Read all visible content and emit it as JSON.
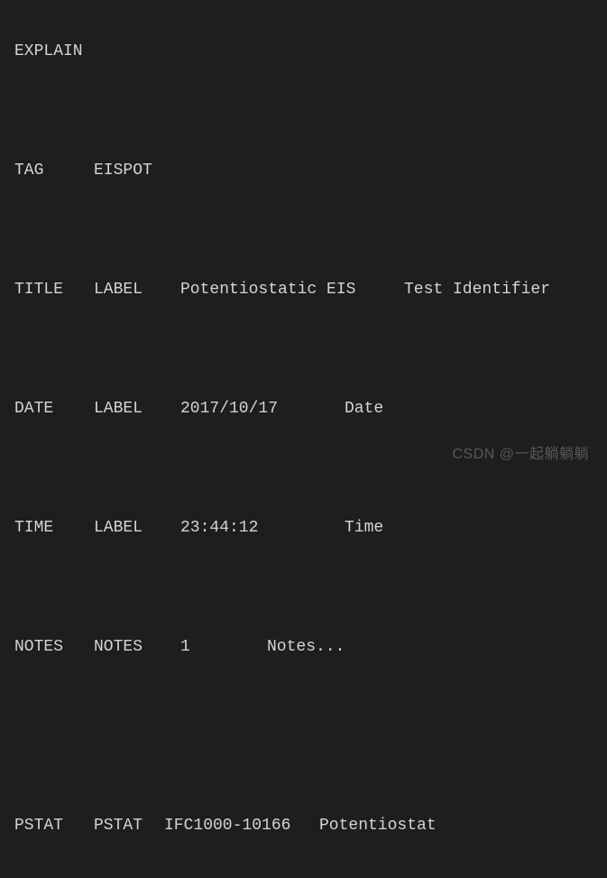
{
  "rows": {
    "explain": {
      "c1": "EXPLAIN"
    },
    "tag": {
      "c1": "TAG",
      "c2": "EISPOT"
    },
    "title": {
      "c1": "TITLE",
      "c2": "LABEL",
      "c3": "Potentiostatic EIS",
      "c4": "Test Identifier"
    },
    "date": {
      "c1": "DATE",
      "c2": "LABEL",
      "c3": "2017/10/17",
      "c4": "Date"
    },
    "time": {
      "c1": "TIME",
      "c2": "LABEL",
      "c3": "23:44:12",
      "c4": "Time"
    },
    "notes": {
      "c1": "NOTES",
      "c2": "NOTES",
      "c3": "1",
      "c4": "Notes..."
    },
    "pstat": {
      "c1": "PSTAT",
      "c2": "PSTAT",
      "c3": "IFC1000-10166",
      "c4": "Potentiostat"
    }
  },
  "watermark": "CSDN @一起躺躺躺"
}
